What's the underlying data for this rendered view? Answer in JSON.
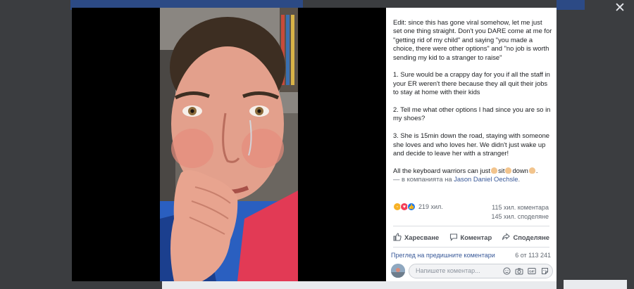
{
  "viewer": {
    "close_icon": "close-icon"
  },
  "post": {
    "paragraphs": [
      "Edit: since this has gone viral somehow, let me just set one thing straight. Don't you DARE come at me for \"getting rid of my child\" and saying \"you made a choice, there were other options\" and \"no job is worth sending my kid to a stranger to raise\"",
      "1. Sure would be a crappy day for you if all the staff in your ER weren't there because they all quit their jobs to stay at home with their kids",
      "2. Tell me what other options I had since you are so in my shoes?",
      "3. She is 15min down the road, staying with someone she loves and who loves her. We didn't just wake up and decide to leave her with a stranger!"
    ],
    "closing_parts": [
      "All the keyboard warriors can just",
      "sit",
      "down",
      "."
    ],
    "tagged_prefix": "— в компанията на",
    "tagged_name": "Jason Daniel Oechsle",
    "tagged_suffix": "."
  },
  "stats": {
    "reactions_count": "219 хил.",
    "comments_count": "115 хил. коментара",
    "shares_count": "145 хил. споделяне",
    "reaction_icons": [
      "haha-icon",
      "love-icon",
      "like-icon"
    ],
    "colors": {
      "haha": "#f7b125",
      "love": "#f33e58",
      "like": "#1877f2"
    }
  },
  "actions": {
    "like": "Харесване",
    "comment": "Коментар",
    "share": "Споделяне"
  },
  "comments": {
    "prev_link": "Преглед на предишните коментари",
    "count": "6 от 113 241",
    "placeholder": "Напишете коментар..."
  }
}
